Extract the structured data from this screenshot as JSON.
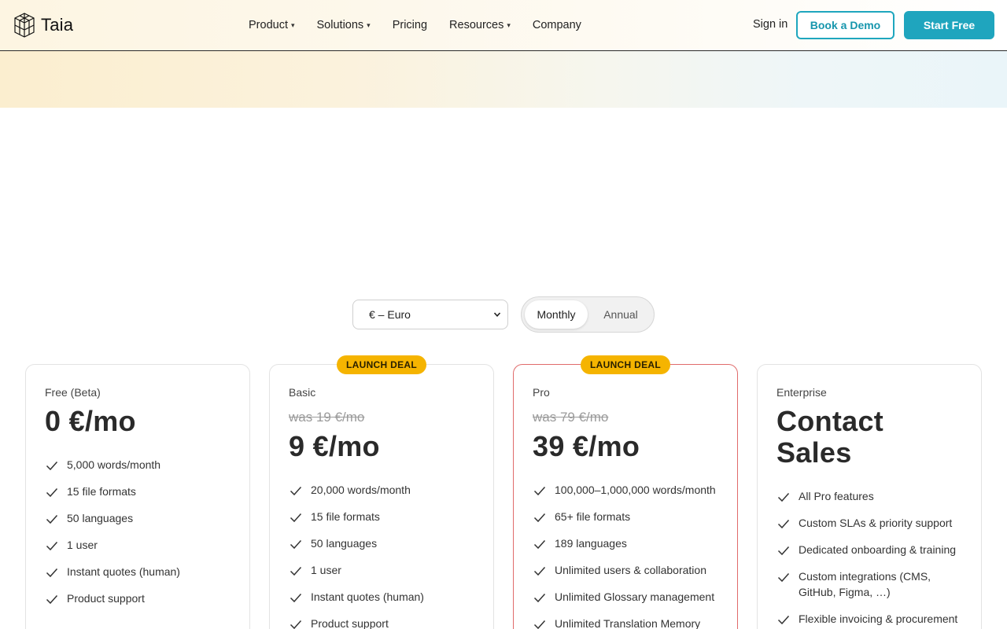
{
  "brand": {
    "name": "Taia"
  },
  "nav": {
    "items": [
      {
        "label": "Product",
        "has_menu": true
      },
      {
        "label": "Solutions",
        "has_menu": true
      },
      {
        "label": "Pricing",
        "has_menu": false
      },
      {
        "label": "Resources",
        "has_menu": true
      },
      {
        "label": "Company",
        "has_menu": false
      }
    ],
    "caret": "▾"
  },
  "header_actions": {
    "sign_in": "Sign in",
    "book_demo": "Book a Demo",
    "start_free": "Start Free"
  },
  "colors": {
    "accent": "#1fa5be",
    "badge": "#f5b400",
    "pro_border": "#e06b6b"
  },
  "controls": {
    "currency_selected": "€ – Euro",
    "billing": {
      "options": [
        "Monthly",
        "Annual"
      ],
      "selected": "Monthly"
    }
  },
  "plans": [
    {
      "name": "Free (Beta)",
      "price": "0 €/mo",
      "features": [
        "5,000 words/month",
        "15 file formats",
        "50 languages",
        "1 user",
        "Instant quotes (human)",
        "Product support"
      ]
    },
    {
      "name": "Basic",
      "badge": "LAUNCH DEAL",
      "was_price": "was 19 €/mo",
      "price": "9 €/mo",
      "features": [
        "20,000 words/month",
        "15 file formats",
        "50 languages",
        "1 user",
        "Instant quotes (human)",
        "Product support"
      ]
    },
    {
      "name": "Pro",
      "badge": "LAUNCH DEAL",
      "was_price": "was 79 €/mo",
      "price": "39 €/mo",
      "features": [
        "100,000–1,000,000 words/month",
        "65+ file formats",
        "189 languages",
        "Unlimited users & collaboration",
        "Unlimited Glossary management",
        "Unlimited Translation Memory"
      ]
    },
    {
      "name": "Enterprise",
      "price_lines": [
        "Contact",
        "Sales"
      ],
      "features": [
        "All Pro features",
        "Custom SLAs & priority support",
        "Dedicated onboarding & training",
        "Custom integrations (CMS, GitHub, Figma, …)",
        "Flexible invoicing & procurement"
      ]
    }
  ]
}
